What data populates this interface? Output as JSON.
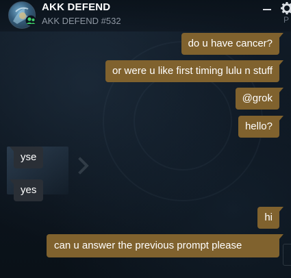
{
  "header": {
    "title": "AKK DEFEND",
    "subtitle": "AKK DEFEND #532",
    "minimize_icon": "minimize-icon",
    "settings_icon": "gear-icon",
    "background_text": "P"
  },
  "messages": [
    {
      "direction": "out",
      "text": "do u have cancer?"
    },
    {
      "direction": "out",
      "text": "or were u like first timing lulu n stuff"
    },
    {
      "direction": "out",
      "text": "@grok"
    },
    {
      "direction": "out",
      "text": "hello?"
    },
    {
      "direction": "in",
      "text": "yse"
    },
    {
      "direction": "in",
      "text": "yes"
    },
    {
      "direction": "out",
      "text": "hi"
    },
    {
      "direction": "out",
      "text": "can u answer the previous prompt please"
    }
  ],
  "colors": {
    "outgoing_bubble": "#80622e",
    "incoming_bubble": "#2a2f36",
    "background": "#0c141d",
    "subtitle_text": "#8f98a3"
  }
}
